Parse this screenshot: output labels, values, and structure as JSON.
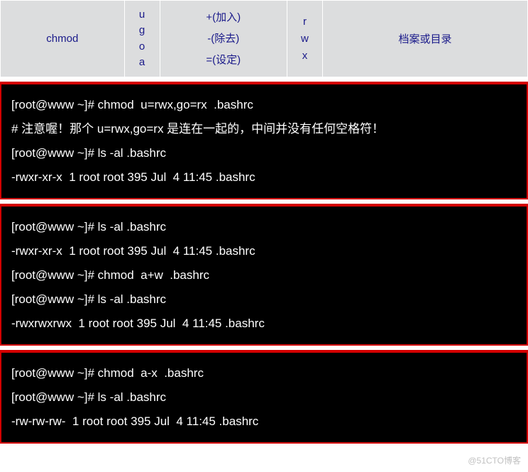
{
  "syntax_table": {
    "command": "chmod",
    "who": [
      "u",
      "g",
      "o",
      "a"
    ],
    "operators": [
      "+(加入)",
      "-(除去)",
      "=(设定)"
    ],
    "perms": [
      "r",
      "w",
      "x"
    ],
    "target": "档案或目录"
  },
  "terminal_blocks": [
    {
      "lines": [
        "[root@www ~]# chmod  u=rwx,go=rx  .bashrc",
        "# 注意喔！那个 u=rwx,go=rx 是连在一起的，中间并没有任何空格符！",
        "[root@www ~]# ls -al .bashrc",
        "-rwxr-xr-x  1 root root 395 Jul  4 11:45 .bashrc"
      ]
    },
    {
      "lines": [
        "[root@www ~]# ls -al .bashrc",
        "-rwxr-xr-x  1 root root 395 Jul  4 11:45 .bashrc",
        "[root@www ~]# chmod  a+w  .bashrc",
        "[root@www ~]# ls -al .bashrc",
        "-rwxrwxrwx  1 root root 395 Jul  4 11:45 .bashrc"
      ]
    },
    {
      "lines": [
        "[root@www ~]# chmod  a-x  .bashrc",
        "[root@www ~]# ls -al .bashrc",
        "-rw-rw-rw-  1 root root 395 Jul  4 11:45 .bashrc"
      ]
    }
  ],
  "watermark": "@51CTO博客"
}
